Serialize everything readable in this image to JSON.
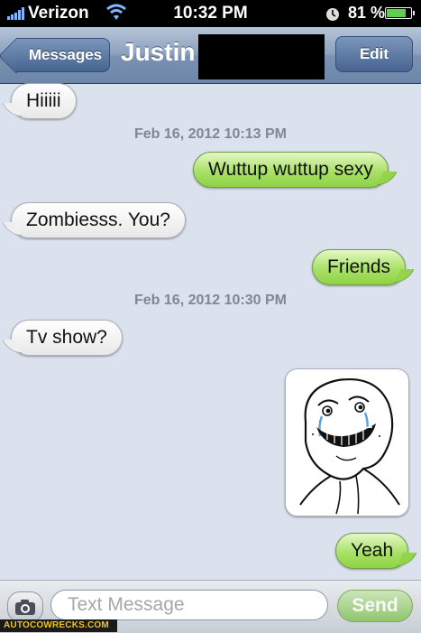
{
  "status_bar": {
    "carrier": "Verizon",
    "time": "10:32 PM",
    "battery_percent": "81 %",
    "battery_level": 0.81,
    "battery_color": "#5cd04a"
  },
  "nav": {
    "back_label": "Messages",
    "title": "Justin",
    "edit_label": "Edit"
  },
  "messages": [
    {
      "direction": "incoming",
      "text": "Hiiiii"
    },
    {
      "type": "timestamp",
      "text": "Feb 16, 2012 10:13 PM"
    },
    {
      "direction": "outgoing",
      "text": "Wuttup wuttup sexy"
    },
    {
      "direction": "incoming",
      "text": "Zombiesss. You?"
    },
    {
      "direction": "outgoing",
      "text": "Friends"
    },
    {
      "type": "timestamp",
      "text": "Feb 16, 2012 10:30 PM"
    },
    {
      "direction": "incoming",
      "text": "Tv show?"
    },
    {
      "direction": "outgoing",
      "type": "image",
      "icon": "forever-alone-meme-face"
    },
    {
      "direction": "outgoing",
      "text": "Yeah"
    }
  ],
  "composer": {
    "placeholder": "Text Message",
    "send_label": "Send",
    "camera_icon": "camera-icon"
  },
  "watermark": "AUTOCOWRECKS.COM",
  "colors": {
    "outgoing_bubble": "#a9e167",
    "incoming_bubble": "#ffffff",
    "background": "#dbe2ed",
    "nav_bar": "#8ba1bd"
  }
}
